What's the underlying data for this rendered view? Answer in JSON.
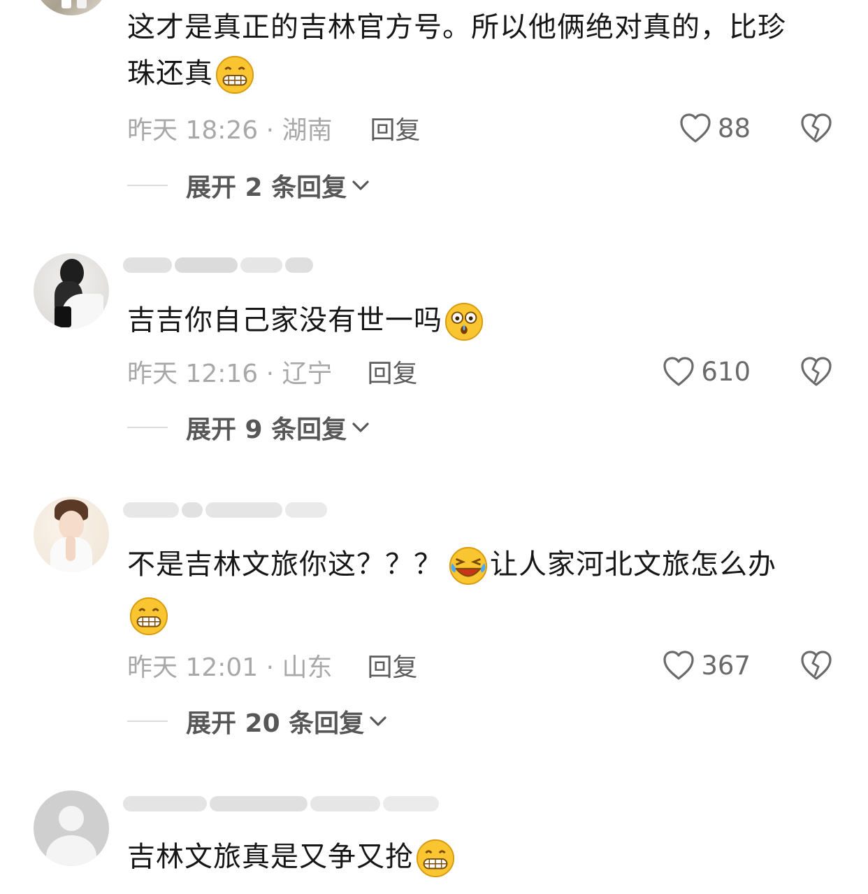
{
  "comments": [
    {
      "text_lines": [
        "这才是真正的吉林官方号。所以他俩绝对真的，比珍",
        "珠还真"
      ],
      "emoji": "grin-emoji",
      "time_location": "昨天 18:26 · 湖南",
      "reply_label": "回复",
      "likes": "88",
      "expand_label": "展开 2 条回复"
    },
    {
      "text": "吉吉你自己家没有世一吗",
      "emoji": "astonished-emoji",
      "time_location": "昨天 12:16 · 辽宁",
      "reply_label": "回复",
      "likes": "610",
      "expand_label": "展开 9 条回复"
    },
    {
      "text_part1": "不是吉林文旅你这？？？",
      "text_part2": "让人家河北文旅怎么办",
      "emoji1": "crying-laughing-emoji",
      "emoji2": "grin-emoji",
      "time_location": "昨天 12:01 · 山东",
      "reply_label": "回复",
      "likes": "367",
      "expand_label": "展开 20 条回复"
    },
    {
      "text": "吉林文旅真是又争又抢",
      "emoji": "grin-emoji"
    }
  ],
  "colors": {
    "meta": "#a8a8a8",
    "reply": "#5c5c5c",
    "emoji_face": "#f9c531"
  }
}
